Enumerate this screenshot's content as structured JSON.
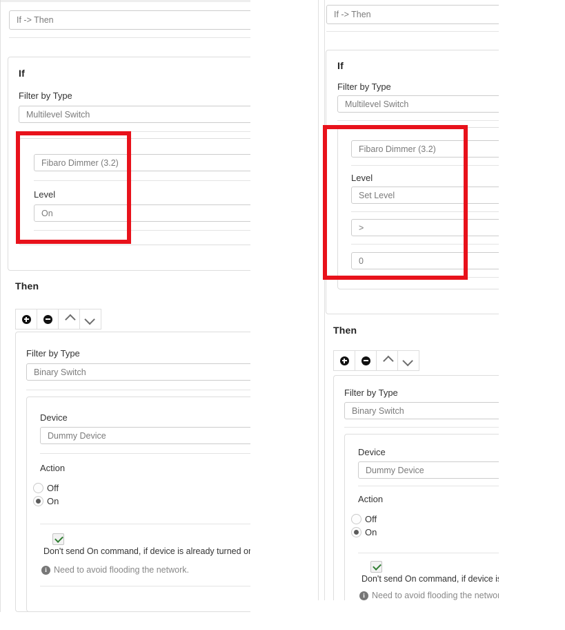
{
  "app": {
    "rule_name_value": "If -> Then"
  },
  "if_section": {
    "heading": "If",
    "filter_label": "Filter by Type",
    "filter_value": "Multilevel Switch",
    "device_value": "Fibaro Dimmer (3.2)",
    "level_label": "Level",
    "level_value_left": "On",
    "level_value_right": "Set Level",
    "operator_value": ">",
    "threshold_value": "0"
  },
  "then_section": {
    "heading": "Then",
    "toolbar": [
      {
        "name": "add-button",
        "icon": "plus-circle-icon"
      },
      {
        "name": "remove-button",
        "icon": "minus-circle-icon"
      },
      {
        "name": "move-up-button",
        "icon": "chevron-up-icon"
      },
      {
        "name": "move-down-button",
        "icon": "chevron-down-icon"
      }
    ],
    "filter_label": "Filter by Type",
    "filter_value": "Binary Switch",
    "device_label": "Device",
    "device_value": "Dummy Device",
    "action_label": "Action",
    "radios": [
      {
        "label": "Off",
        "selected": false
      },
      {
        "label": "On",
        "selected": true
      }
    ],
    "checkbox_label": "Don't send On command, if device is already turned on",
    "checkbox_checked": true,
    "note_text": "Need to avoid flooding the network.",
    "note_icon": "info-icon"
  },
  "highlights": [
    {
      "name": "highlight-box-left",
      "color": "#e8121b"
    },
    {
      "name": "highlight-box-right",
      "color": "#e8121b"
    }
  ]
}
